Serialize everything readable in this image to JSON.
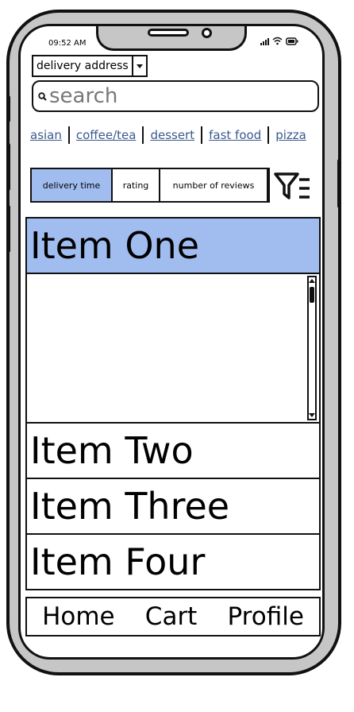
{
  "status_bar": {
    "time": "09:52 AM"
  },
  "address": {
    "label": "delivery address"
  },
  "search": {
    "placeholder": "search"
  },
  "categories": [
    "asian",
    "coffee/tea",
    "dessert",
    "fast food",
    "pizza"
  ],
  "sort_tabs": [
    {
      "label": "delivery time",
      "active": true
    },
    {
      "label": "rating",
      "active": false
    },
    {
      "label": "number of reviews",
      "active": false
    }
  ],
  "items": [
    {
      "label": "Item One",
      "selected": true
    },
    {
      "label": "Item Two",
      "selected": false
    },
    {
      "label": "Item Three",
      "selected": false
    },
    {
      "label": "Item Four",
      "selected": false
    }
  ],
  "nav": {
    "home": "Home",
    "cart": "Cart",
    "profile": "Profile"
  },
  "colors": {
    "accent": "#a1bdf0",
    "link": "#3a5b8e",
    "frame": "#c6c6c6"
  },
  "icons": {
    "search": "search-icon",
    "filter": "filter-icon",
    "dropdown": "chevron-down-icon"
  }
}
